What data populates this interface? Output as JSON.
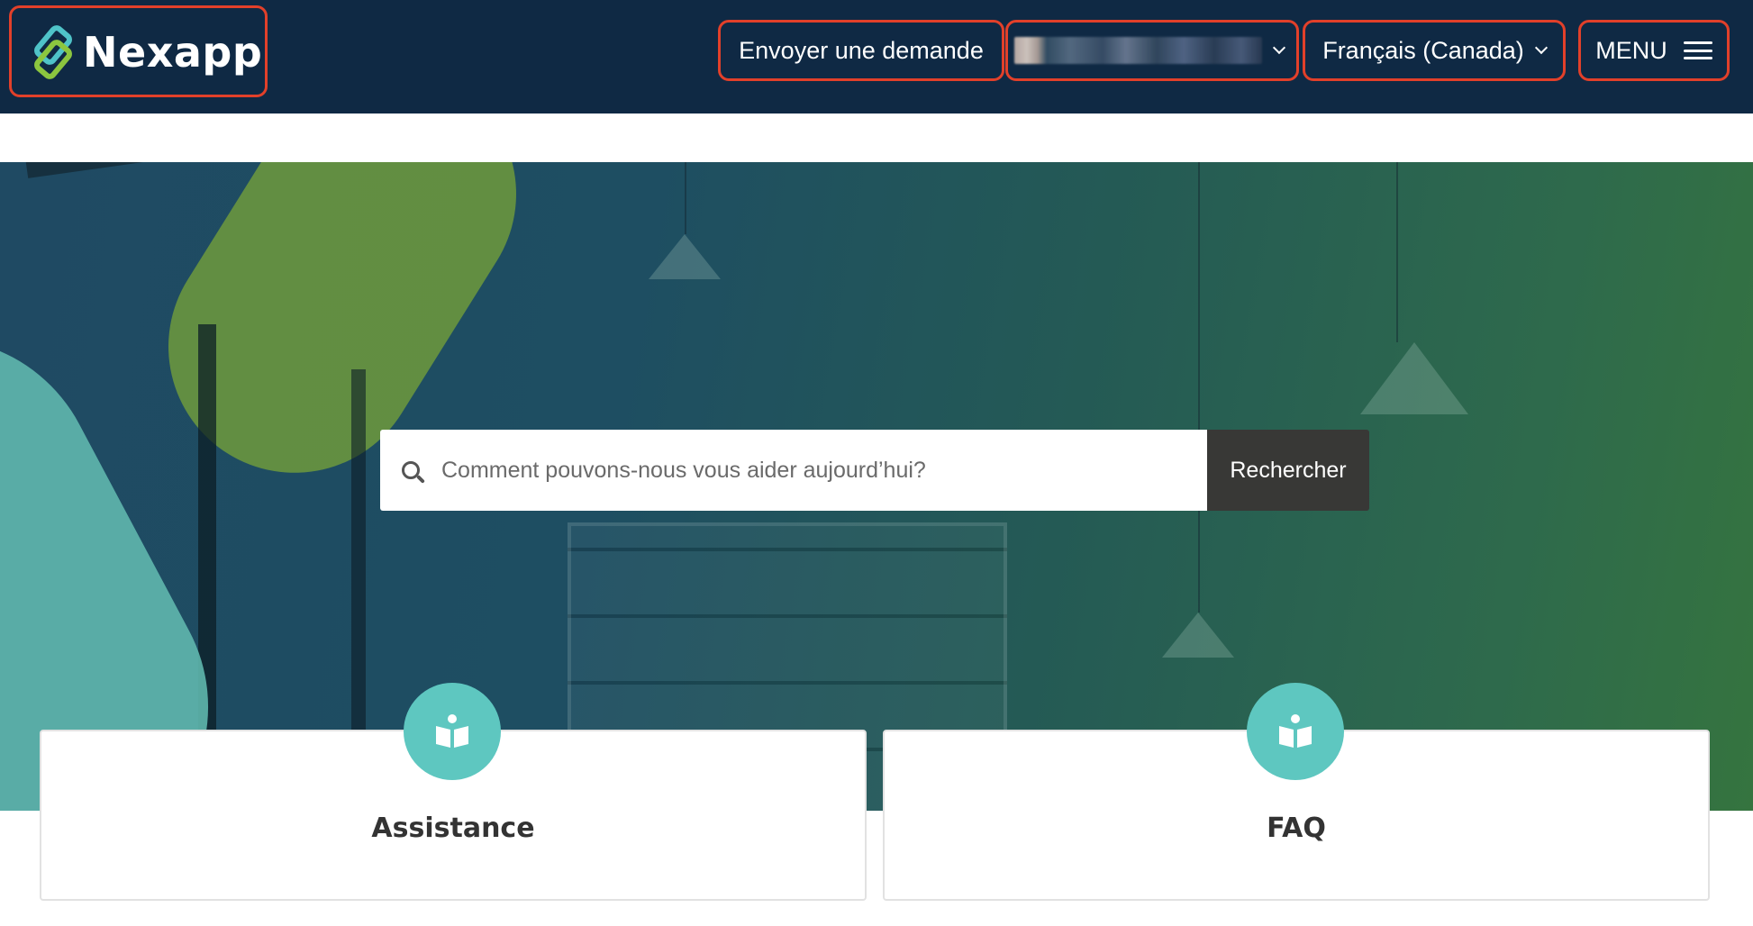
{
  "header": {
    "logo_text": "Nexapp",
    "request_label": "Envoyer une demande",
    "language_label": "Français (Canada)",
    "menu_label": "MENU"
  },
  "search": {
    "placeholder": "Comment pouvons-nous vous aider aujourd’hui?",
    "button_label": "Rechercher"
  },
  "cards": [
    {
      "title": "Assistance",
      "icon": "open-book-icon"
    },
    {
      "title": "FAQ",
      "icon": "open-book-icon"
    }
  ],
  "colors": {
    "header_bg": "#0f2944",
    "highlight": "#e2402a",
    "accent": "#5ec7c0",
    "search_button": "#383836"
  }
}
